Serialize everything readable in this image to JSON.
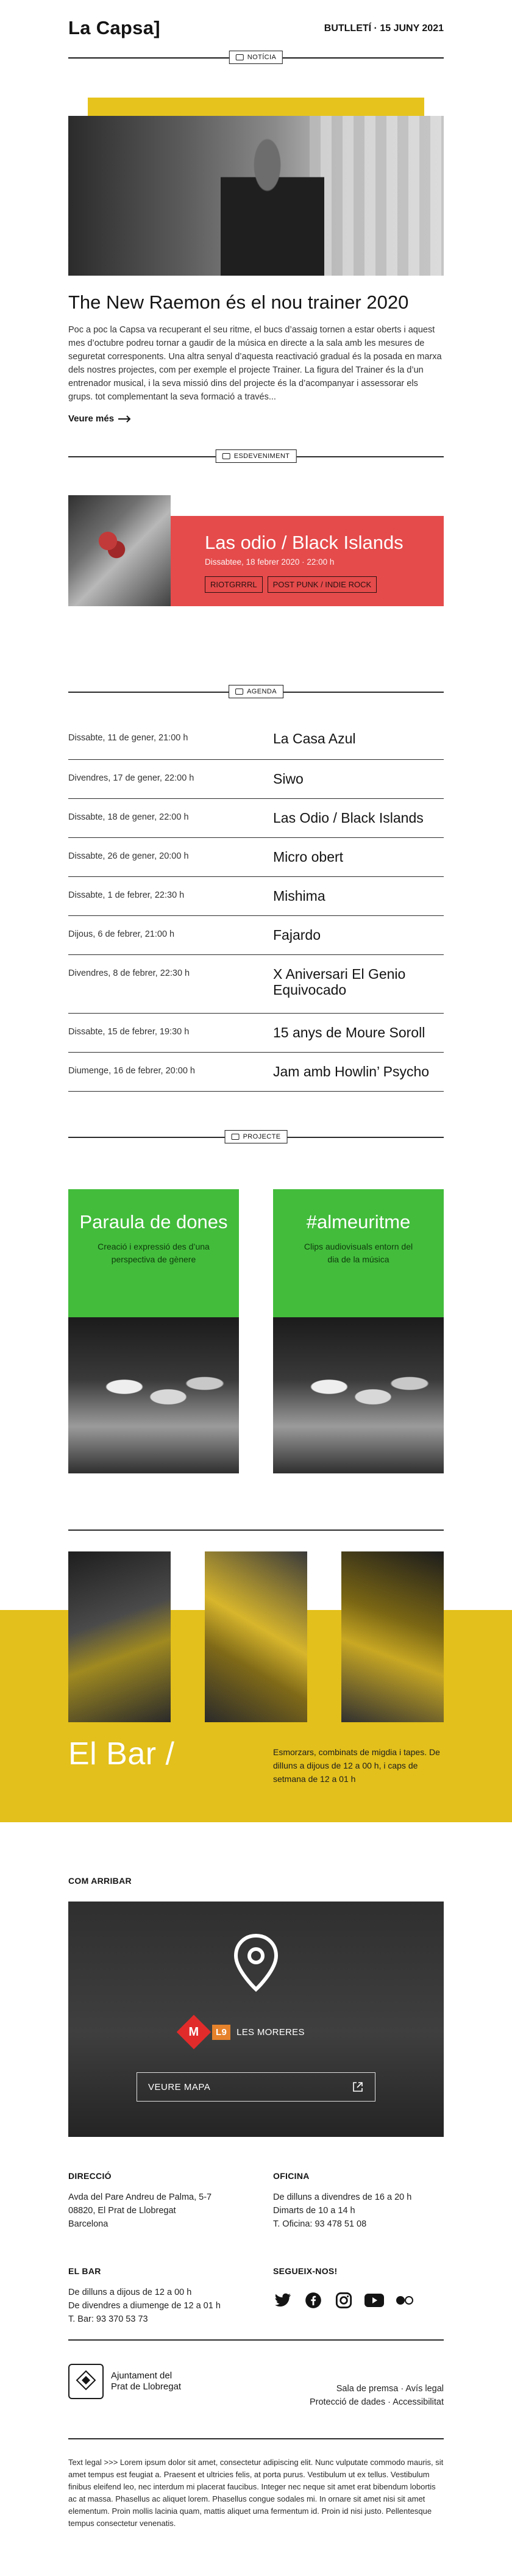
{
  "header": {
    "logo": "La Capsa]",
    "bulletin_label": "BUTLLETÍ",
    "bulletin_date": "15 JUNY 2021"
  },
  "news": {
    "section_label": "NOTÍCIA",
    "title": "The New Raemon és el nou trainer 2020",
    "body": "Poc a poc la Capsa va recuperant el seu ritme, el bucs d’assaig tornen a estar oberts i aquest mes d’octubre podreu tornar a gaudir de la música en directe a la sala amb les mesures de seguretat corresponents. Una altra senyal d’aquesta reactivació gradual és la posada en marxa dels nostres projectes, com per exemple el projecte Trainer. La figura del Trainer és la d’un entrenador musical, i la seva missió dins del projecte és la d’acompanyar i assessorar els grups. tot complementant la seva formació a través...",
    "more": "Veure més"
  },
  "event": {
    "section_label": "ESDEVENIMENT",
    "title": "Las odio / Black Islands",
    "date": "Dissabtee, 18 febrer 2020 · 22:00 h",
    "tags": [
      "RIOTGRRRL",
      "POST PUNK / INDIE ROCK"
    ]
  },
  "agenda": {
    "section_label": "AGENDA",
    "rows": [
      {
        "when": "Dissabte, 11 de gener, 21:00 h",
        "what": "La Casa Azul"
      },
      {
        "when": "Divendres, 17 de gener, 22:00 h",
        "what": "Siwo"
      },
      {
        "when": "Dissabte, 18 de gener, 22:00 h",
        "what": "Las Odio / Black Islands"
      },
      {
        "when": "Dissabte, 26 de gener, 20:00 h",
        "what": "Micro obert"
      },
      {
        "when": "Dissabte, 1 de febrer, 22:30 h",
        "what": "Mishima"
      },
      {
        "when": "Dijous, 6 de febrer, 21:00 h",
        "what": "Fajardo"
      },
      {
        "when": "Divendres, 8 de febrer, 22:30 h",
        "what": "X Aniversari El Genio Equivocado"
      },
      {
        "when": "Dissabte, 15 de febrer, 19:30 h",
        "what": "15 anys de Moure Soroll"
      },
      {
        "when": "Diumenge, 16 de febrer, 20:00 h",
        "what": "Jam amb Howlin’ Psycho"
      }
    ]
  },
  "projects": {
    "section_label": "PROJECTE",
    "items": [
      {
        "title": "Paraula de dones",
        "desc": "Creació i expressió des d’una perspectiva de gènere"
      },
      {
        "title": "#almeuritme",
        "desc": "Clips audiovisuals entorn del dia de la música"
      }
    ]
  },
  "bar": {
    "title": "El Bar /",
    "desc": "Esmorzars, combinats de migdia i tapes. De dilluns a dijous de 12 a 00 h, i caps de setmana de 12 a 01 h"
  },
  "map": {
    "heading": "COM ARRIBAR",
    "metro": "M",
    "line": "L9",
    "station": "LES MORERES",
    "button": "VEURE MAPA"
  },
  "info": {
    "direccio_h": "DIRECCIÓ",
    "direccio_t": [
      "Avda del Pare Andreu de Palma, 5-7",
      "08820, El Prat de Llobregat",
      "Barcelona"
    ],
    "oficina_h": "OFICINA",
    "oficina_t": [
      "De dilluns a divendres de 16 a 20 h",
      "Dimarts de 10 a 14 h",
      "T. Oficina: 93 478 51 08"
    ],
    "bar_h": "EL BAR",
    "bar_t": [
      "De dilluns a dijous de 12 a 00 h",
      "De divendres a diumenge de 12 a 01 h",
      "T. Bar: 93 370 53 73"
    ],
    "follow_h": "SEGUEIX-NOS!",
    "socials": [
      "twitter-icon",
      "facebook-icon",
      "instagram-icon",
      "youtube-icon",
      "flickr-icon"
    ]
  },
  "footer": {
    "ajuntament": [
      "Ajuntament del",
      "Prat de Llobregat"
    ],
    "links_row1": [
      "Sala de premsa",
      "Avís legal"
    ],
    "links_row2": [
      "Protecció de dades",
      "Accessibilitat"
    ],
    "legal": "Text legal >>> Lorem ipsum dolor sit amet, consectetur adipiscing elit. Nunc vulputate commodo mauris, sit amet tempus est feugiat a. Praesent et ultricies felis, at porta purus. Vestibulum ut ex tellus. Vestibulum finibus eleifend leo, nec interdum mi placerat faucibus. Integer nec neque sit amet erat bibendum lobortis ac at massa. Phasellus ac aliquet lorem. Phasellus congue sodales mi. In ornare sit amet nisi sit amet elementum. Proin mollis lacinia quam, mattis aliquet urna fermentum id. Proin id nisi justo. Pellentesque tempus consectetur venenatis."
  },
  "colors": {
    "yellow": "#e3c01b",
    "red": "#e54b4b",
    "green": "#43bc3c",
    "dark": "#141414"
  }
}
